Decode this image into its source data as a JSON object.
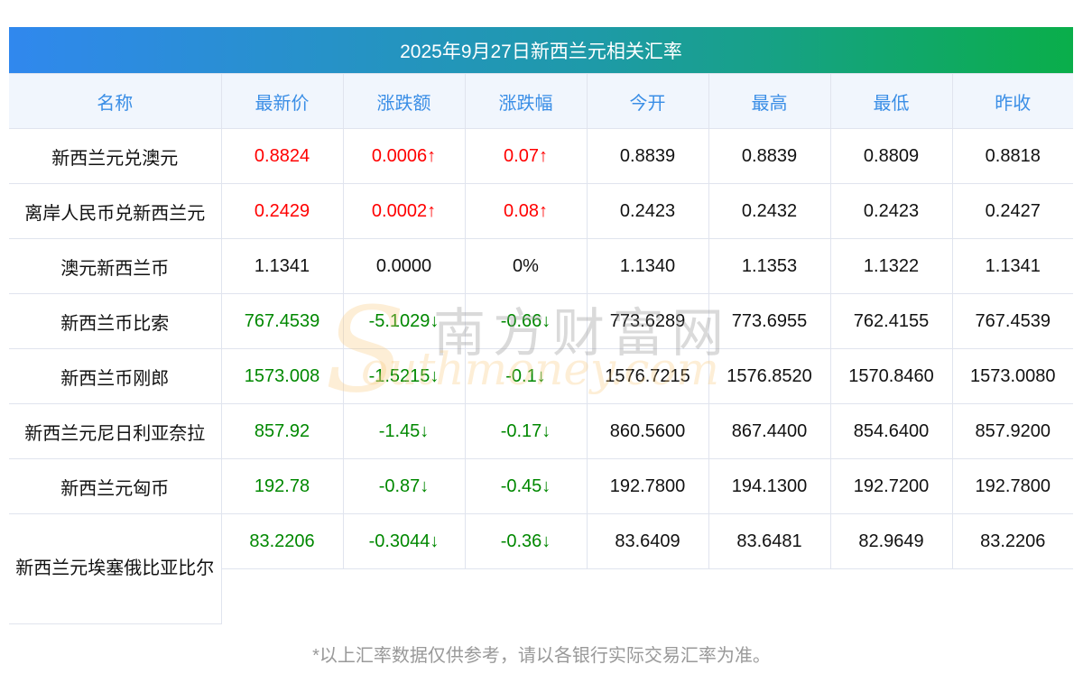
{
  "title": "2025年9月27日新西兰元相关汇率",
  "headers": [
    "名称",
    "最新价",
    "涨跌额",
    "涨跌幅",
    "今开",
    "最高",
    "最低",
    "昨收"
  ],
  "rows": [
    {
      "name": "新西兰元兑澳元",
      "dir": "up",
      "cells": [
        "0.8824",
        "0.0006↑",
        "0.07↑",
        "0.8839",
        "0.8839",
        "0.8809",
        "0.8818"
      ]
    },
    {
      "name": "离岸人民币兑新西兰元",
      "dir": "up",
      "cells": [
        "0.2429",
        "0.0002↑",
        "0.08↑",
        "0.2423",
        "0.2432",
        "0.2423",
        "0.2427"
      ]
    },
    {
      "name": "澳元新西兰币",
      "dir": "flat",
      "cells": [
        "1.1341",
        "0.0000",
        "0%",
        "1.1340",
        "1.1353",
        "1.1322",
        "1.1341"
      ]
    },
    {
      "name": "新西兰币比索",
      "dir": "down",
      "cells": [
        "767.4539",
        "-5.1029↓",
        "-0.66↓",
        "773.6289",
        "773.6955",
        "762.4155",
        "767.4539"
      ]
    },
    {
      "name": "新西兰币刚郎",
      "dir": "down",
      "cells": [
        "1573.008",
        "-1.5215↓",
        "-0.1↓",
        "1576.7215",
        "1576.8520",
        "1570.8460",
        "1573.0080"
      ]
    },
    {
      "name": "新西兰元尼日利亚奈拉",
      "dir": "down",
      "cells": [
        "857.92",
        "-1.45↓",
        "-0.17↓",
        "860.5600",
        "867.4400",
        "854.6400",
        "857.9200"
      ]
    },
    {
      "name": "新西兰元匈币",
      "dir": "down",
      "cells": [
        "192.78",
        "-0.87↓",
        "-0.45↓",
        "192.7800",
        "194.1300",
        "192.7200",
        "192.7800"
      ]
    },
    {
      "name": "新西兰元埃塞俄比亚比尔",
      "dir": "down",
      "cells": [
        "83.2206",
        "-0.3044↓",
        "-0.36↓",
        "83.6409",
        "83.6481",
        "82.9649",
        "83.2206"
      ]
    }
  ],
  "watermark": {
    "cn": "南方财富网",
    "en": "outhmoney.com",
    "s": "S"
  },
  "footer": "*以上汇率数据仅供参考，请以各银行实际交易汇率为准。"
}
